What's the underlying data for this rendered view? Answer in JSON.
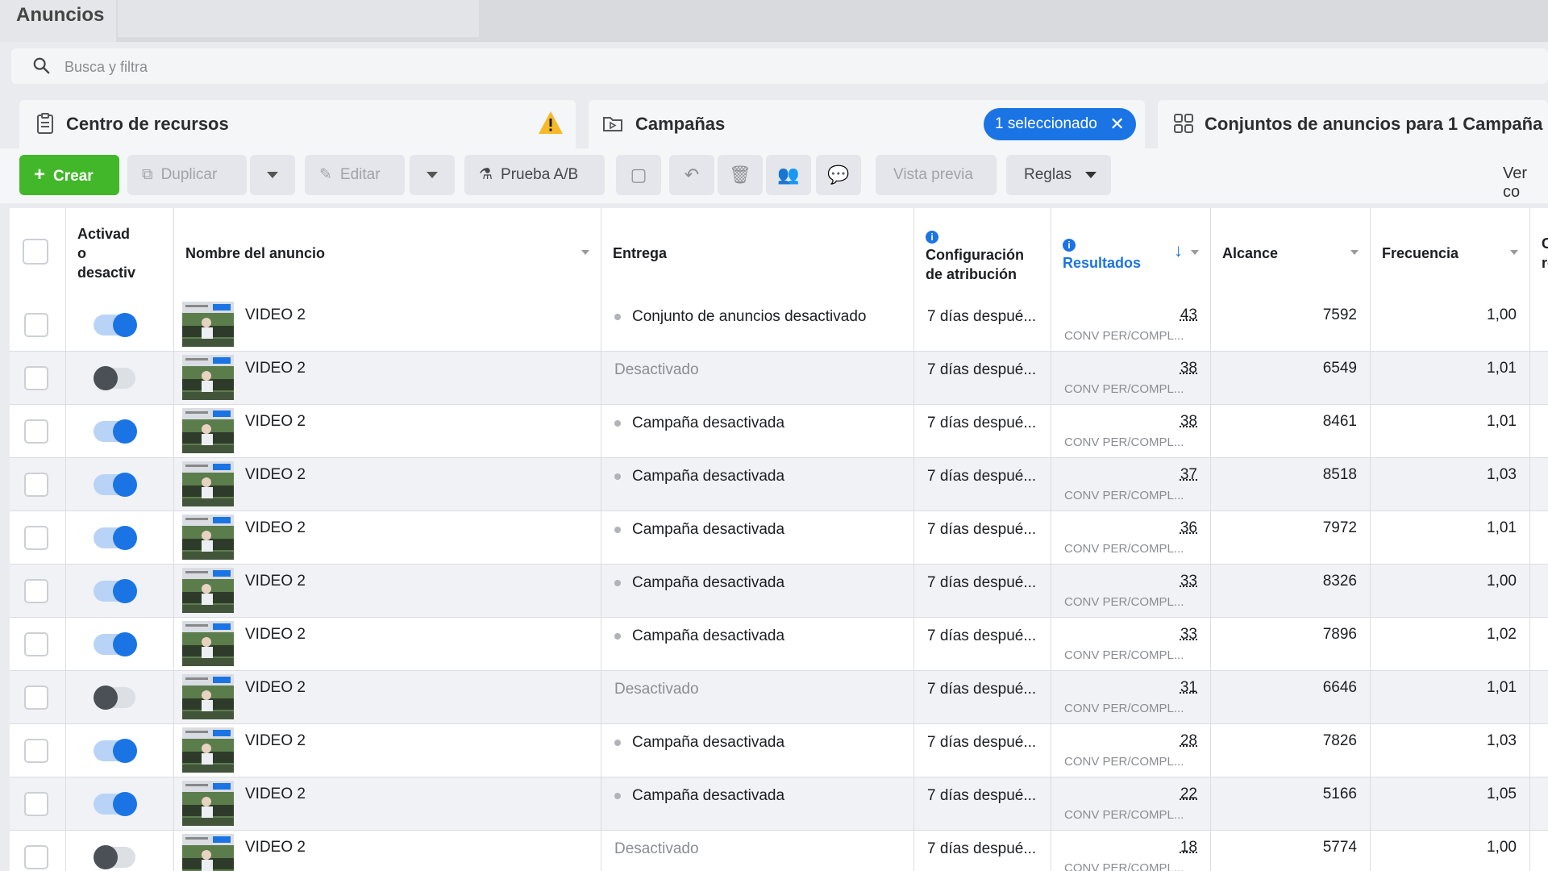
{
  "tabs": {
    "active": "Anuncios"
  },
  "search": {
    "placeholder": "Busca y filtra"
  },
  "panels": {
    "resources": "Centro de recursos",
    "campaigns": "Campañas",
    "selected_badge": "1 seleccionado",
    "adsets": "Conjuntos de anuncios para 1 Campaña"
  },
  "toolbar": {
    "create": "Crear",
    "duplicate": "Duplicar",
    "edit": "Editar",
    "ab_test": "Prueba A/B",
    "preview": "Vista previa",
    "rules": "Reglas",
    "view_more": "Ver co"
  },
  "table": {
    "headers": {
      "toggle": "Activado o desactivado",
      "toggle_lines": [
        "Activad",
        "o",
        "desactiv"
      ],
      "name": "Nombre del anuncio",
      "delivery": "Entrega",
      "attribution_lines": [
        "Configuración",
        "de atribución"
      ],
      "results": "Resultados",
      "reach": "Alcance",
      "frequency": "Frecuencia",
      "last_lines": [
        "Co",
        "re"
      ]
    },
    "rows": [
      {
        "on": true,
        "name": "VIDEO 2",
        "delivery": "Conjunto de anuncios desactivado",
        "muted": false,
        "attribution": "7 días despué...",
        "results": "43",
        "results_type": "CONV PER/COMPL...",
        "reach": "7592",
        "frequency": "1,00"
      },
      {
        "on": false,
        "name": "VIDEO 2",
        "delivery": "Desactivado",
        "muted": true,
        "attribution": "7 días despué...",
        "results": "38",
        "results_type": "CONV PER/COMPL...",
        "reach": "6549",
        "frequency": "1,01"
      },
      {
        "on": true,
        "name": "VIDEO 2",
        "delivery": "Campaña desactivada",
        "muted": false,
        "attribution": "7 días despué...",
        "results": "38",
        "results_type": "CONV PER/COMPL...",
        "reach": "8461",
        "frequency": "1,01"
      },
      {
        "on": true,
        "name": "VIDEO 2",
        "delivery": "Campaña desactivada",
        "muted": false,
        "attribution": "7 días despué...",
        "results": "37",
        "results_type": "CONV PER/COMPL...",
        "reach": "8518",
        "frequency": "1,03"
      },
      {
        "on": true,
        "name": "VIDEO 2",
        "delivery": "Campaña desactivada",
        "muted": false,
        "attribution": "7 días despué...",
        "results": "36",
        "results_type": "CONV PER/COMPL...",
        "reach": "7972",
        "frequency": "1,01"
      },
      {
        "on": true,
        "name": "VIDEO 2",
        "delivery": "Campaña desactivada",
        "muted": false,
        "attribution": "7 días despué...",
        "results": "33",
        "results_type": "CONV PER/COMPL...",
        "reach": "8326",
        "frequency": "1,00"
      },
      {
        "on": true,
        "name": "VIDEO 2",
        "delivery": "Campaña desactivada",
        "muted": false,
        "attribution": "7 días despué...",
        "results": "33",
        "results_type": "CONV PER/COMPL...",
        "reach": "7896",
        "frequency": "1,02"
      },
      {
        "on": false,
        "name": "VIDEO 2",
        "delivery": "Desactivado",
        "muted": true,
        "attribution": "7 días despué...",
        "results": "31",
        "results_type": "CONV PER/COMPL...",
        "reach": "6646",
        "frequency": "1,01"
      },
      {
        "on": true,
        "name": "VIDEO 2",
        "delivery": "Campaña desactivada",
        "muted": false,
        "attribution": "7 días despué...",
        "results": "28",
        "results_type": "CONV PER/COMPL...",
        "reach": "7826",
        "frequency": "1,03"
      },
      {
        "on": true,
        "name": "VIDEO 2",
        "delivery": "Campaña desactivada",
        "muted": false,
        "attribution": "7 días despué...",
        "results": "22",
        "results_type": "CONV PER/COMPL...",
        "reach": "5166",
        "frequency": "1,05"
      },
      {
        "on": false,
        "name": "VIDEO 2",
        "delivery": "Desactivado",
        "muted": true,
        "attribution": "7 días despué...",
        "results": "18",
        "results_type": "CONV PER/COMPL...",
        "reach": "5774",
        "frequency": "1,00"
      }
    ]
  },
  "colors": {
    "accent": "#1b74e4",
    "create_green": "#42b72a",
    "warning": "#f7b928"
  }
}
